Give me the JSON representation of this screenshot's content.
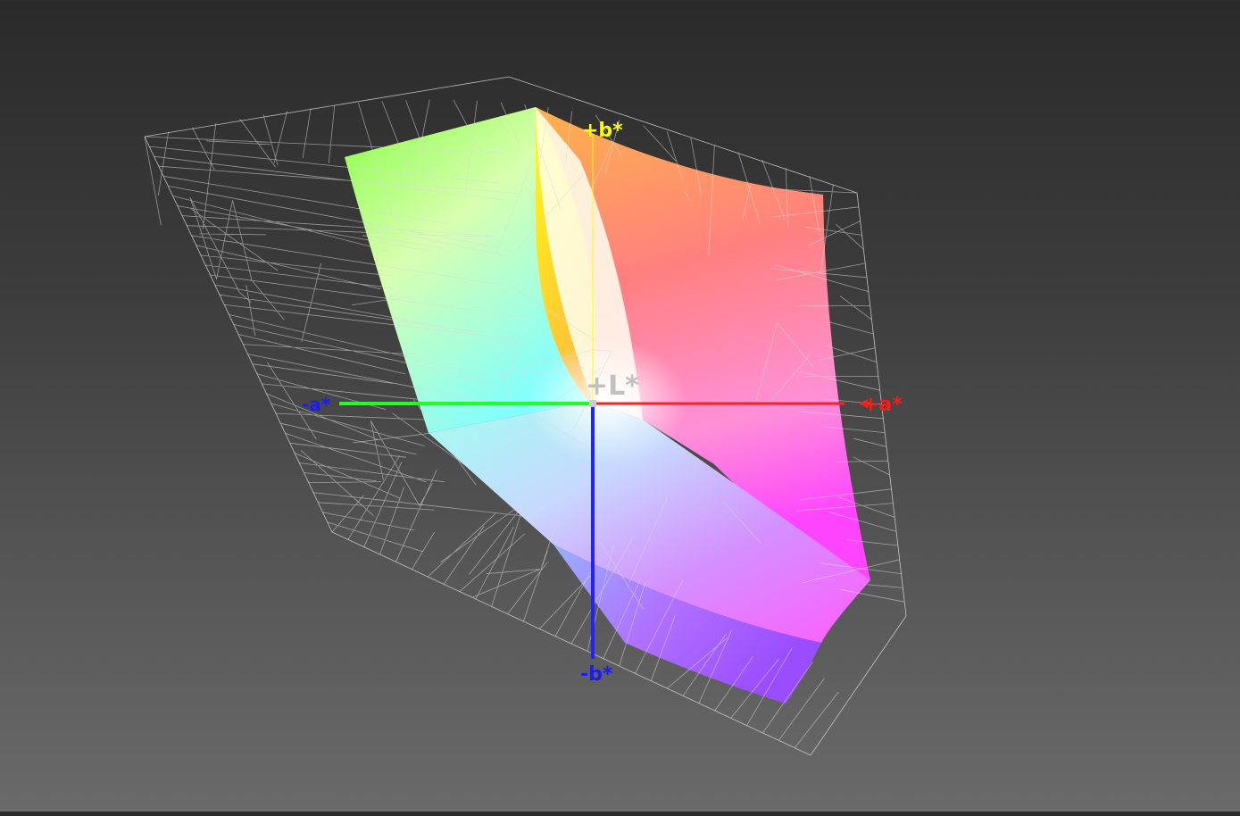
{
  "gamut_view": {
    "axes": {
      "plus_b": {
        "label": "+b*",
        "color": "#ffff00"
      },
      "minus_b": {
        "label": "-b*",
        "color": "#1a1aff"
      },
      "plus_a": {
        "label": "+a*",
        "color": "#ff1a1a"
      },
      "minus_a": {
        "label": "-a*",
        "color": "#1a1aff"
      },
      "plus_L": {
        "label": "+L*",
        "color": "#bbbbbb"
      }
    },
    "solid_colors": {
      "yellow": "#ffff00",
      "green": "#66ff33",
      "cyan": "#66ffff",
      "blue": "#7f99ff",
      "violet": "#a855ff",
      "magenta": "#ff44ff",
      "red": "#ff5a5a",
      "white": "#ffffff"
    },
    "wireframe_color": "#d8d8d8"
  }
}
